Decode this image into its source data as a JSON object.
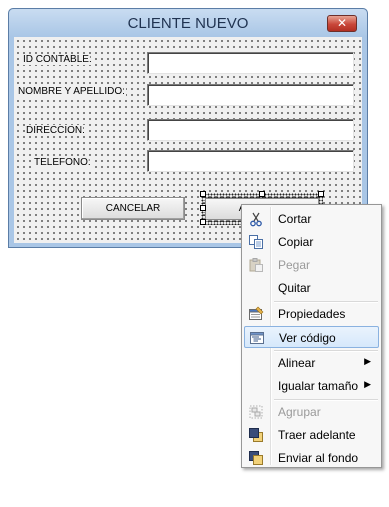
{
  "form": {
    "title": "CLIENTE NUEVO",
    "close_glyph": "✕",
    "fields": [
      {
        "label": "ID CONTABLE:",
        "value": ""
      },
      {
        "label": "NOMBRE Y APELLIDO:",
        "value": ""
      },
      {
        "label": "DIRECCION:",
        "value": ""
      },
      {
        "label": "TELEFONO:",
        "value": ""
      }
    ],
    "cancel_label": "CANCELAR",
    "accept_label": "ACEPTAR"
  },
  "context_menu": {
    "items": [
      {
        "label": "Cortar",
        "icon": "scissors-icon",
        "enabled": true
      },
      {
        "label": "Copiar",
        "icon": "copy-icon",
        "enabled": true
      },
      {
        "label": "Pegar",
        "icon": "paste-icon",
        "enabled": false
      },
      {
        "label": "Quitar",
        "icon": "",
        "enabled": true
      },
      {
        "label": "Propiedades",
        "icon": "properties-icon",
        "enabled": true
      },
      {
        "label": "Ver código",
        "icon": "view-code-icon",
        "enabled": true,
        "highlighted": true
      },
      {
        "label": "Alinear",
        "icon": "",
        "enabled": true,
        "submenu": true
      },
      {
        "label": "Igualar tamaño",
        "icon": "",
        "enabled": true,
        "submenu": true
      },
      {
        "label": "Agrupar",
        "icon": "group-icon",
        "enabled": false
      },
      {
        "label": "Traer adelante",
        "icon": "bring-to-front-icon",
        "enabled": true
      },
      {
        "label": "Enviar al fondo",
        "icon": "send-to-back-icon",
        "enabled": true
      }
    ],
    "submenu_glyph": "▶"
  },
  "colors": {
    "window_frame": "#a9c6e6",
    "close_button": "#c9473a",
    "menu_highlight": "#d6e8fb",
    "menu_highlight_border": "#8ab2e0"
  }
}
